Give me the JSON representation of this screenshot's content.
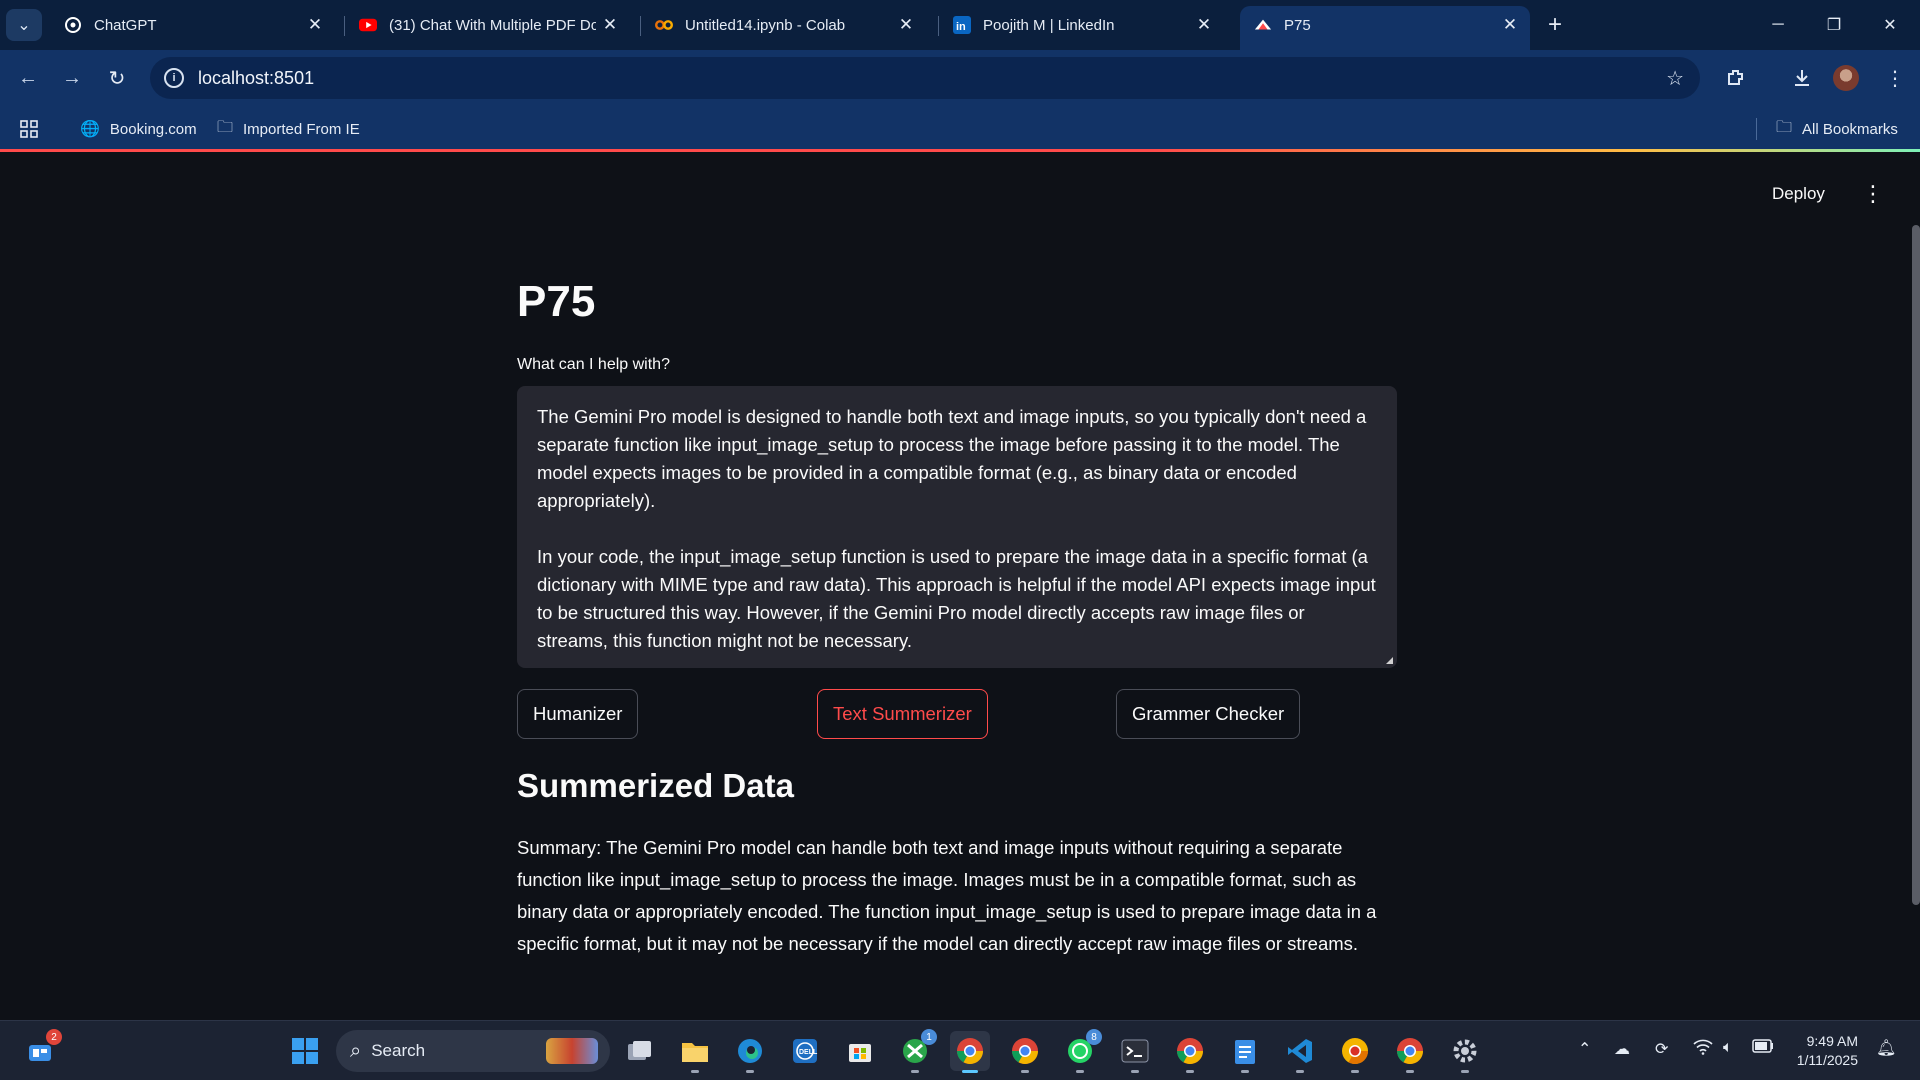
{
  "browser": {
    "tabs": [
      {
        "title": "ChatGPT",
        "icon": "chatgpt-icon"
      },
      {
        "title": "(31) Chat With Multiple PDF Do",
        "icon": "youtube-icon"
      },
      {
        "title": "Untitled14.ipynb - Colab",
        "icon": "colab-icon"
      },
      {
        "title": "Poojith M | LinkedIn",
        "icon": "linkedin-icon"
      },
      {
        "title": "P75",
        "icon": "streamlit-icon",
        "active": true
      }
    ],
    "url": "localhost:8501",
    "bookmarks": [
      {
        "label": "Booking.com",
        "icon": "globe-icon"
      },
      {
        "label": "Imported From IE",
        "icon": "folder-icon"
      }
    ],
    "all_bookmarks": "All Bookmarks"
  },
  "app": {
    "deploy": "Deploy",
    "title": "P75",
    "input_label": "What can I help with?",
    "input_paragraphs": [
      "The Gemini Pro model is designed to handle both text and image inputs, so you typically don't need a separate function like input_image_setup to process the image before passing it to the model. The model expects images to be provided in a compatible format (e.g., as binary data or encoded appropriately).",
      "In your code, the input_image_setup function is used to prepare the image data in a specific format (a dictionary with MIME type and raw data). This approach is helpful if the model API expects image input to be structured this way. However, if the Gemini Pro model directly accepts raw image files or streams, this function might not be necessary."
    ],
    "buttons": {
      "humanizer": "Humanizer",
      "summarizer": "Text Summerizer",
      "grammar": "Grammer Checker"
    },
    "active_button": "summarizer",
    "accent_color": "#ff4b4b",
    "section_title": "Summerized Data",
    "summary": "Summary: The Gemini Pro model can handle both text and image inputs without requiring a separate function like input_image_setup to process the image. Images must be in a compatible format, such as binary data or appropriately encoded. The function input_image_setup is used to prepare image data in a specific format, but it may not be necessary if the model can directly accept raw image files or streams."
  },
  "taskbar": {
    "search_placeholder": "Search",
    "widgets_badge": "2",
    "xbox_badge": "1",
    "whatsapp_badge": "8",
    "time": "9:49 AM",
    "date": "1/11/2025"
  }
}
